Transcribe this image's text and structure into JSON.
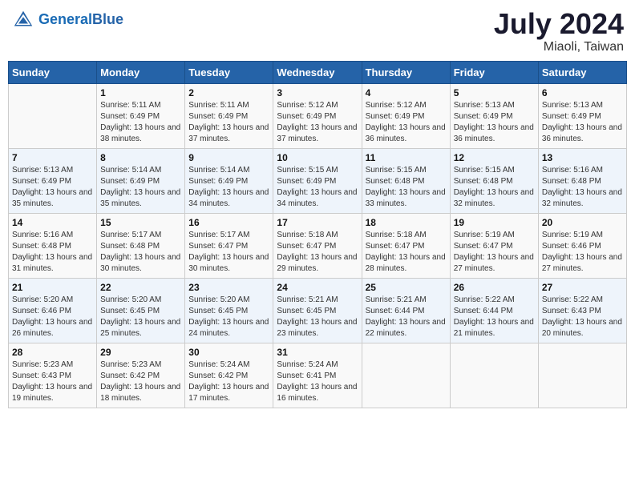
{
  "header": {
    "logo_line1": "General",
    "logo_line2": "Blue",
    "month_year": "July 2024",
    "location": "Miaoli, Taiwan"
  },
  "days_of_week": [
    "Sunday",
    "Monday",
    "Tuesday",
    "Wednesday",
    "Thursday",
    "Friday",
    "Saturday"
  ],
  "weeks": [
    [
      {
        "day": "",
        "sunrise": "",
        "sunset": "",
        "daylight": ""
      },
      {
        "day": "1",
        "sunrise": "Sunrise: 5:11 AM",
        "sunset": "Sunset: 6:49 PM",
        "daylight": "Daylight: 13 hours and 38 minutes."
      },
      {
        "day": "2",
        "sunrise": "Sunrise: 5:11 AM",
        "sunset": "Sunset: 6:49 PM",
        "daylight": "Daylight: 13 hours and 37 minutes."
      },
      {
        "day": "3",
        "sunrise": "Sunrise: 5:12 AM",
        "sunset": "Sunset: 6:49 PM",
        "daylight": "Daylight: 13 hours and 37 minutes."
      },
      {
        "day": "4",
        "sunrise": "Sunrise: 5:12 AM",
        "sunset": "Sunset: 6:49 PM",
        "daylight": "Daylight: 13 hours and 36 minutes."
      },
      {
        "day": "5",
        "sunrise": "Sunrise: 5:13 AM",
        "sunset": "Sunset: 6:49 PM",
        "daylight": "Daylight: 13 hours and 36 minutes."
      },
      {
        "day": "6",
        "sunrise": "Sunrise: 5:13 AM",
        "sunset": "Sunset: 6:49 PM",
        "daylight": "Daylight: 13 hours and 36 minutes."
      }
    ],
    [
      {
        "day": "7",
        "sunrise": "Sunrise: 5:13 AM",
        "sunset": "Sunset: 6:49 PM",
        "daylight": "Daylight: 13 hours and 35 minutes."
      },
      {
        "day": "8",
        "sunrise": "Sunrise: 5:14 AM",
        "sunset": "Sunset: 6:49 PM",
        "daylight": "Daylight: 13 hours and 35 minutes."
      },
      {
        "day": "9",
        "sunrise": "Sunrise: 5:14 AM",
        "sunset": "Sunset: 6:49 PM",
        "daylight": "Daylight: 13 hours and 34 minutes."
      },
      {
        "day": "10",
        "sunrise": "Sunrise: 5:15 AM",
        "sunset": "Sunset: 6:49 PM",
        "daylight": "Daylight: 13 hours and 34 minutes."
      },
      {
        "day": "11",
        "sunrise": "Sunrise: 5:15 AM",
        "sunset": "Sunset: 6:48 PM",
        "daylight": "Daylight: 13 hours and 33 minutes."
      },
      {
        "day": "12",
        "sunrise": "Sunrise: 5:15 AM",
        "sunset": "Sunset: 6:48 PM",
        "daylight": "Daylight: 13 hours and 32 minutes."
      },
      {
        "day": "13",
        "sunrise": "Sunrise: 5:16 AM",
        "sunset": "Sunset: 6:48 PM",
        "daylight": "Daylight: 13 hours and 32 minutes."
      }
    ],
    [
      {
        "day": "14",
        "sunrise": "Sunrise: 5:16 AM",
        "sunset": "Sunset: 6:48 PM",
        "daylight": "Daylight: 13 hours and 31 minutes."
      },
      {
        "day": "15",
        "sunrise": "Sunrise: 5:17 AM",
        "sunset": "Sunset: 6:48 PM",
        "daylight": "Daylight: 13 hours and 30 minutes."
      },
      {
        "day": "16",
        "sunrise": "Sunrise: 5:17 AM",
        "sunset": "Sunset: 6:47 PM",
        "daylight": "Daylight: 13 hours and 30 minutes."
      },
      {
        "day": "17",
        "sunrise": "Sunrise: 5:18 AM",
        "sunset": "Sunset: 6:47 PM",
        "daylight": "Daylight: 13 hours and 29 minutes."
      },
      {
        "day": "18",
        "sunrise": "Sunrise: 5:18 AM",
        "sunset": "Sunset: 6:47 PM",
        "daylight": "Daylight: 13 hours and 28 minutes."
      },
      {
        "day": "19",
        "sunrise": "Sunrise: 5:19 AM",
        "sunset": "Sunset: 6:47 PM",
        "daylight": "Daylight: 13 hours and 27 minutes."
      },
      {
        "day": "20",
        "sunrise": "Sunrise: 5:19 AM",
        "sunset": "Sunset: 6:46 PM",
        "daylight": "Daylight: 13 hours and 27 minutes."
      }
    ],
    [
      {
        "day": "21",
        "sunrise": "Sunrise: 5:20 AM",
        "sunset": "Sunset: 6:46 PM",
        "daylight": "Daylight: 13 hours and 26 minutes."
      },
      {
        "day": "22",
        "sunrise": "Sunrise: 5:20 AM",
        "sunset": "Sunset: 6:45 PM",
        "daylight": "Daylight: 13 hours and 25 minutes."
      },
      {
        "day": "23",
        "sunrise": "Sunrise: 5:20 AM",
        "sunset": "Sunset: 6:45 PM",
        "daylight": "Daylight: 13 hours and 24 minutes."
      },
      {
        "day": "24",
        "sunrise": "Sunrise: 5:21 AM",
        "sunset": "Sunset: 6:45 PM",
        "daylight": "Daylight: 13 hours and 23 minutes."
      },
      {
        "day": "25",
        "sunrise": "Sunrise: 5:21 AM",
        "sunset": "Sunset: 6:44 PM",
        "daylight": "Daylight: 13 hours and 22 minutes."
      },
      {
        "day": "26",
        "sunrise": "Sunrise: 5:22 AM",
        "sunset": "Sunset: 6:44 PM",
        "daylight": "Daylight: 13 hours and 21 minutes."
      },
      {
        "day": "27",
        "sunrise": "Sunrise: 5:22 AM",
        "sunset": "Sunset: 6:43 PM",
        "daylight": "Daylight: 13 hours and 20 minutes."
      }
    ],
    [
      {
        "day": "28",
        "sunrise": "Sunrise: 5:23 AM",
        "sunset": "Sunset: 6:43 PM",
        "daylight": "Daylight: 13 hours and 19 minutes."
      },
      {
        "day": "29",
        "sunrise": "Sunrise: 5:23 AM",
        "sunset": "Sunset: 6:42 PM",
        "daylight": "Daylight: 13 hours and 18 minutes."
      },
      {
        "day": "30",
        "sunrise": "Sunrise: 5:24 AM",
        "sunset": "Sunset: 6:42 PM",
        "daylight": "Daylight: 13 hours and 17 minutes."
      },
      {
        "day": "31",
        "sunrise": "Sunrise: 5:24 AM",
        "sunset": "Sunset: 6:41 PM",
        "daylight": "Daylight: 13 hours and 16 minutes."
      },
      {
        "day": "",
        "sunrise": "",
        "sunset": "",
        "daylight": ""
      },
      {
        "day": "",
        "sunrise": "",
        "sunset": "",
        "daylight": ""
      },
      {
        "day": "",
        "sunrise": "",
        "sunset": "",
        "daylight": ""
      }
    ]
  ]
}
